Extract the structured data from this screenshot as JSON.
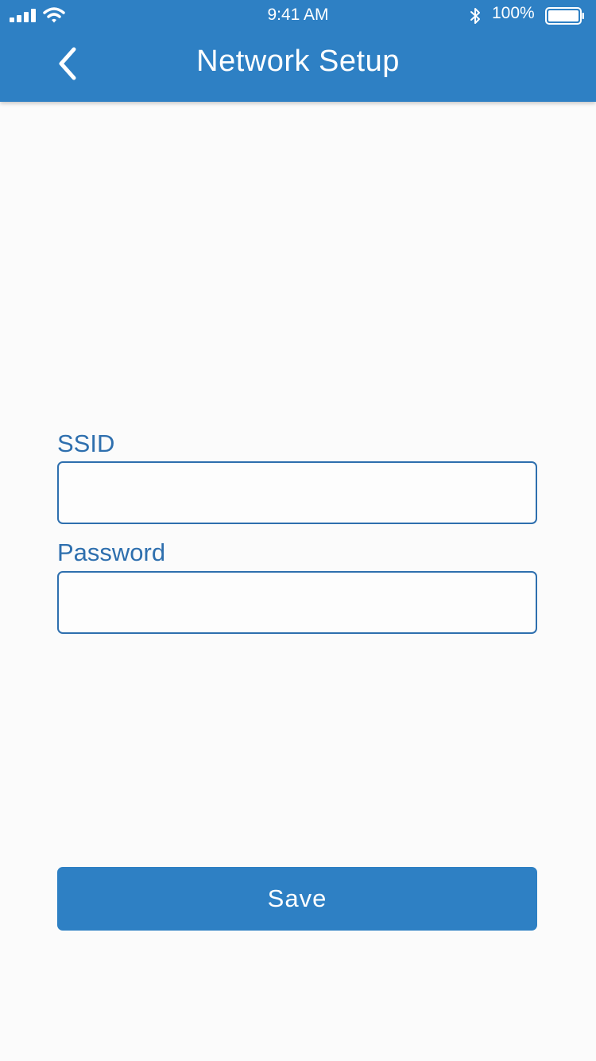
{
  "colors": {
    "header": "#2e80c4",
    "accent": "#2e6fae",
    "background": "#fbfbfb",
    "button": "#2e80c4"
  },
  "status_bar": {
    "time": "9:41 AM",
    "battery_percent": "100%",
    "signal_icon": "cellular-signal-icon",
    "wifi_icon": "wifi-icon",
    "bluetooth_icon": "bluetooth-icon",
    "battery_icon": "battery-icon"
  },
  "header": {
    "title": "Network Setup",
    "back_icon": "chevron-left-icon"
  },
  "form": {
    "ssid": {
      "label": "SSID",
      "value": "",
      "placeholder": ""
    },
    "password": {
      "label": "Password",
      "value": "",
      "placeholder": ""
    }
  },
  "actions": {
    "save_label": "Save"
  }
}
